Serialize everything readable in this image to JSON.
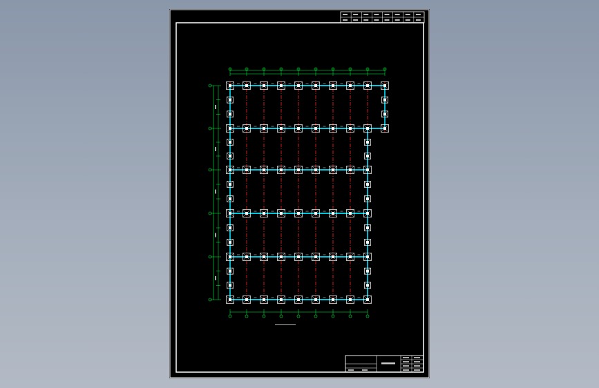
{
  "app": {
    "viewport_background_top": "#8a97aa",
    "viewport_background_bottom": "#b3bac5"
  },
  "sheet": {
    "paper_color": "#000000",
    "frame_color": "#ffffff"
  },
  "drawing": {
    "title_caption": "",
    "title_scale": "",
    "colors": {
      "grid_line": "#e02020",
      "beam": "#00e5ff",
      "foundation": "#ffffff",
      "dimension": "#00ff40",
      "column": "#ffffff"
    }
  },
  "title_block": {
    "top_stamp_cells": 8,
    "bottom_cells": 6
  }
}
